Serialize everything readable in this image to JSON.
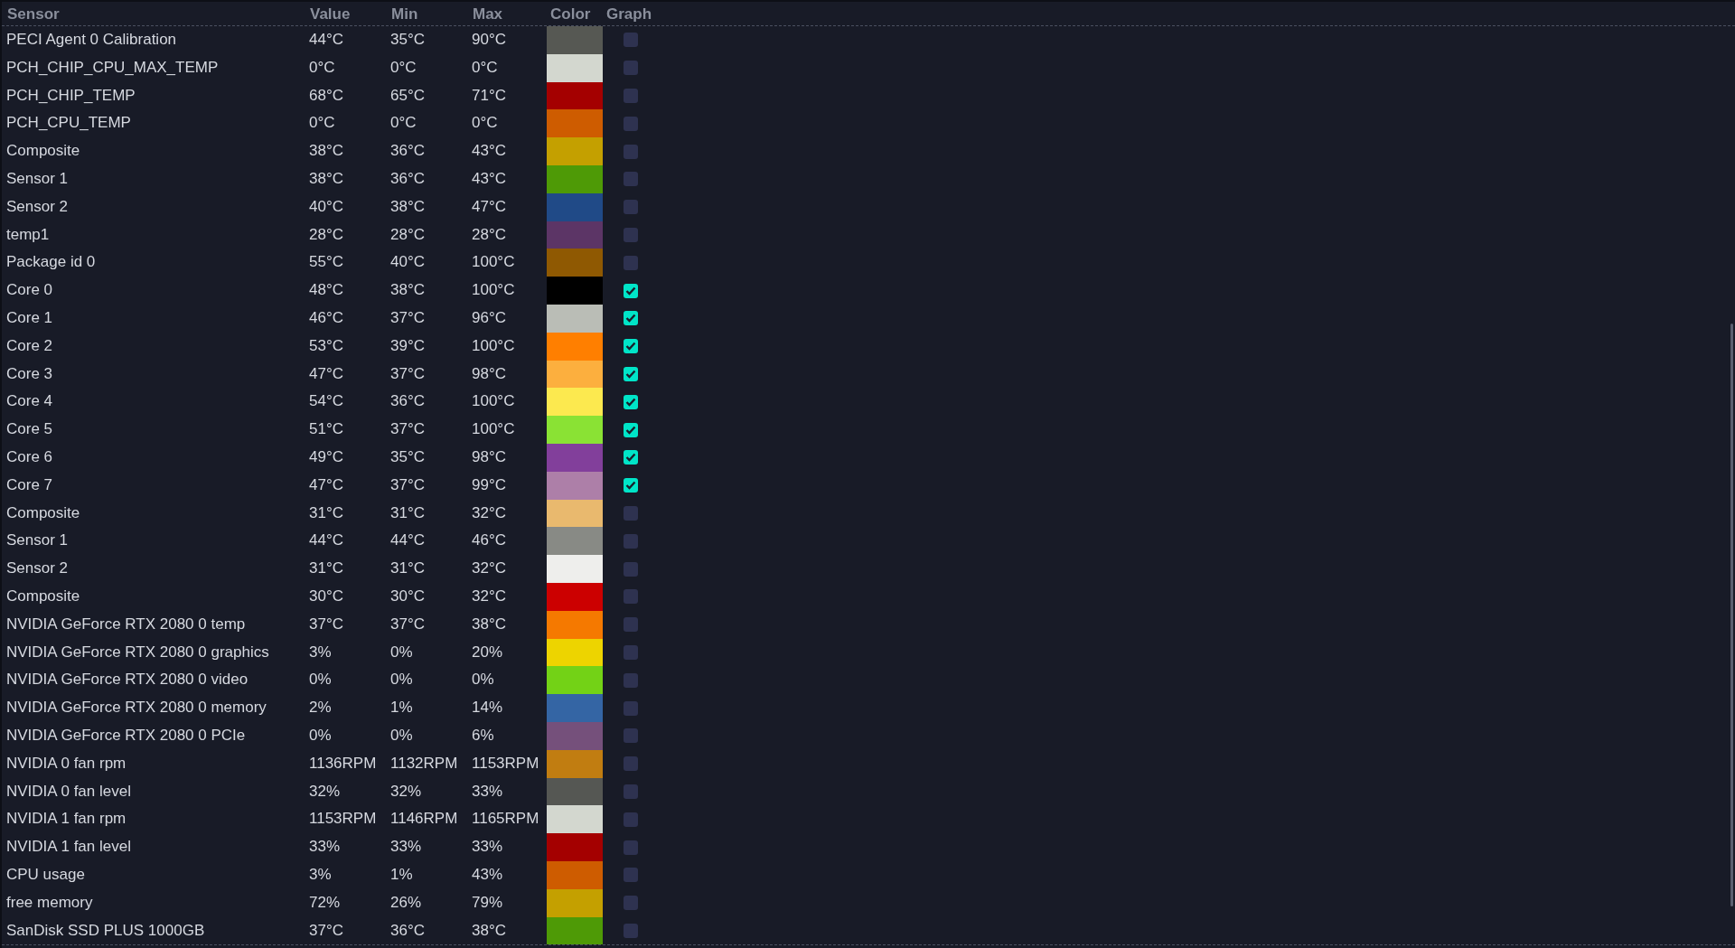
{
  "columns": [
    "Sensor",
    "Value",
    "Min",
    "Max",
    "Color",
    "Graph"
  ],
  "rows": [
    {
      "name": "PECI Agent 0 Calibration",
      "value": "44°C",
      "min": "35°C",
      "max": "90°C",
      "color": "#565853",
      "graph": false
    },
    {
      "name": "PCH_CHIP_CPU_MAX_TEMP",
      "value": "0°C",
      "min": "0°C",
      "max": "0°C",
      "color": "#d3d7cf",
      "graph": false
    },
    {
      "name": "PCH_CHIP_TEMP",
      "value": "68°C",
      "min": "65°C",
      "max": "71°C",
      "color": "#a40000",
      "graph": false
    },
    {
      "name": "PCH_CPU_TEMP",
      "value": "0°C",
      "min": "0°C",
      "max": "0°C",
      "color": "#ce5c00",
      "graph": false
    },
    {
      "name": "Composite",
      "value": "38°C",
      "min": "36°C",
      "max": "43°C",
      "color": "#c4a000",
      "graph": false
    },
    {
      "name": "Sensor 1",
      "value": "38°C",
      "min": "36°C",
      "max": "43°C",
      "color": "#4e9a06",
      "graph": false
    },
    {
      "name": "Sensor 2",
      "value": "40°C",
      "min": "38°C",
      "max": "47°C",
      "color": "#204a87",
      "graph": false
    },
    {
      "name": "temp1",
      "value": "28°C",
      "min": "28°C",
      "max": "28°C",
      "color": "#5c3566",
      "graph": false
    },
    {
      "name": "Package id 0",
      "value": "55°C",
      "min": "40°C",
      "max": "100°C",
      "color": "#8f5902",
      "graph": false
    },
    {
      "name": "Core 0",
      "value": "48°C",
      "min": "38°C",
      "max": "100°C",
      "color": "#000000",
      "graph": true
    },
    {
      "name": "Core 1",
      "value": "46°C",
      "min": "37°C",
      "max": "96°C",
      "color": "#babdb6",
      "graph": true
    },
    {
      "name": "Core 2",
      "value": "53°C",
      "min": "39°C",
      "max": "100°C",
      "color": "#ff7f00",
      "graph": true
    },
    {
      "name": "Core 3",
      "value": "47°C",
      "min": "37°C",
      "max": "98°C",
      "color": "#fcaf3e",
      "graph": true
    },
    {
      "name": "Core 4",
      "value": "54°C",
      "min": "36°C",
      "max": "100°C",
      "color": "#fce94f",
      "graph": true
    },
    {
      "name": "Core 5",
      "value": "51°C",
      "min": "37°C",
      "max": "100°C",
      "color": "#8ae234",
      "graph": true
    },
    {
      "name": "Core 6",
      "value": "49°C",
      "min": "35°C",
      "max": "98°C",
      "color": "#823f9b",
      "graph": true
    },
    {
      "name": "Core 7",
      "value": "47°C",
      "min": "37°C",
      "max": "99°C",
      "color": "#ad7fa8",
      "graph": true
    },
    {
      "name": "Composite",
      "value": "31°C",
      "min": "31°C",
      "max": "32°C",
      "color": "#e9b96e",
      "graph": false
    },
    {
      "name": "Sensor 1",
      "value": "44°C",
      "min": "44°C",
      "max": "46°C",
      "color": "#888a85",
      "graph": false
    },
    {
      "name": "Sensor 2",
      "value": "31°C",
      "min": "31°C",
      "max": "32°C",
      "color": "#eeeeec",
      "graph": false
    },
    {
      "name": "Composite",
      "value": "30°C",
      "min": "30°C",
      "max": "32°C",
      "color": "#cc0000",
      "graph": false
    },
    {
      "name": "NVIDIA GeForce RTX 2080 0 temp",
      "value": "37°C",
      "min": "37°C",
      "max": "38°C",
      "color": "#f57900",
      "graph": false
    },
    {
      "name": "NVIDIA GeForce RTX 2080 0 graphics",
      "value": "3%",
      "min": "0%",
      "max": "20%",
      "color": "#edd400",
      "graph": false
    },
    {
      "name": "NVIDIA GeForce RTX 2080 0 video",
      "value": "0%",
      "min": "0%",
      "max": "0%",
      "color": "#73d216",
      "graph": false
    },
    {
      "name": "NVIDIA GeForce RTX 2080 0 memory",
      "value": "2%",
      "min": "1%",
      "max": "14%",
      "color": "#3465a4",
      "graph": false
    },
    {
      "name": "NVIDIA GeForce RTX 2080 0 PCIe",
      "value": "0%",
      "min": "0%",
      "max": "6%",
      "color": "#75507b",
      "graph": false
    },
    {
      "name": "NVIDIA 0 fan rpm",
      "value": "1136RPM",
      "min": "1132RPM",
      "max": "1153RPM",
      "color": "#c17d11",
      "graph": false
    },
    {
      "name": "NVIDIA 0 fan level",
      "value": "32%",
      "min": "32%",
      "max": "33%",
      "color": "#555753",
      "graph": false
    },
    {
      "name": "NVIDIA 1 fan rpm",
      "value": "1153RPM",
      "min": "1146RPM",
      "max": "1165RPM",
      "color": "#d3d7cf",
      "graph": false
    },
    {
      "name": "NVIDIA 1 fan level",
      "value": "33%",
      "min": "33%",
      "max": "33%",
      "color": "#a40000",
      "graph": false
    },
    {
      "name": "CPU usage",
      "value": "3%",
      "min": "1%",
      "max": "43%",
      "color": "#ce5c00",
      "graph": false
    },
    {
      "name": "free memory",
      "value": "72%",
      "min": "26%",
      "max": "79%",
      "color": "#c4a000",
      "graph": false
    },
    {
      "name": "SanDisk SSD PLUS 1000GB",
      "value": "37°C",
      "min": "36°C",
      "max": "38°C",
      "color": "#4e9a06",
      "graph": false
    }
  ]
}
